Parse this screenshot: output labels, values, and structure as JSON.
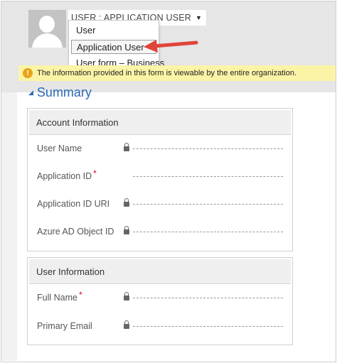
{
  "header": {
    "form_selector_label": "USER : APPLICATION USER",
    "dropdown_items": [
      "User",
      "Application User",
      "User form – Business"
    ],
    "info_message": "The information provided in this form is viewable by the entire organization."
  },
  "summary": {
    "title": "Summary",
    "sections": [
      {
        "title": "Account Information",
        "fields": [
          {
            "label": "User Name",
            "required": false,
            "locked": true
          },
          {
            "label": "Application ID",
            "required": true,
            "locked": false
          },
          {
            "label": "Application ID URI",
            "required": false,
            "locked": true
          },
          {
            "label": "Azure AD Object ID",
            "required": false,
            "locked": true
          }
        ]
      },
      {
        "title": "User Information",
        "fields": [
          {
            "label": "Full Name",
            "required": true,
            "locked": true
          },
          {
            "label": "Primary Email",
            "required": false,
            "locked": true
          }
        ]
      }
    ]
  },
  "colors": {
    "accent": "#2a6ab7",
    "warning": "#e8a317",
    "info_bar": "#fbf4a6",
    "required": "#d0021b",
    "annotation_arrow": "#e0443b"
  },
  "icons": [
    "user-avatar-icon",
    "caret-down-icon",
    "warning-icon",
    "collapse-triangle-icon",
    "lock-icon"
  ]
}
